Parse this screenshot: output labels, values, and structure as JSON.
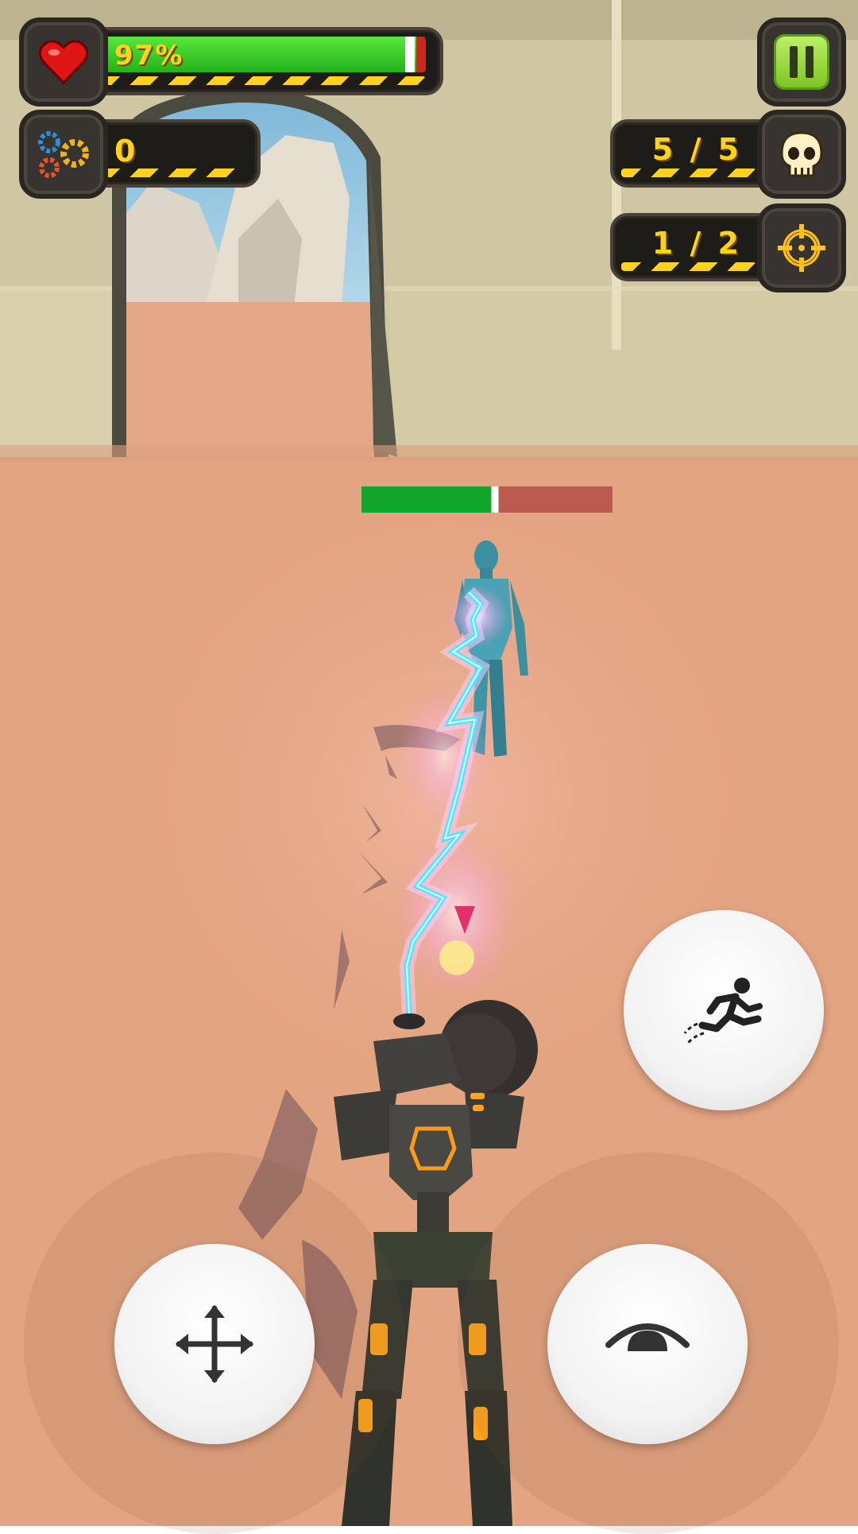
{
  "hud": {
    "health": {
      "icon": "heart-icon",
      "label": "97%",
      "level": 0.97
    },
    "gears": {
      "icon": "gears-icon",
      "count": "0"
    },
    "kills": {
      "icon": "skull-icon",
      "label": "5 / 5"
    },
    "targets": {
      "icon": "crosshair-icon",
      "label": "1 / 2"
    },
    "pause": {
      "icon": "pause-icon"
    }
  },
  "enemy": {
    "health_level": 0.53
  },
  "controls": {
    "dash": {
      "icon": "running-man-icon"
    },
    "move": {
      "icon": "move-arrows-icon"
    },
    "look": {
      "icon": "eye-icon"
    }
  },
  "colors": {
    "ground": "#e3a482",
    "wall": "#cfc6a3",
    "health_green": "#2ec81e",
    "enemy_green": "#12a62c",
    "enemy_red": "#bb5a4f",
    "hud_yellow": "#ffd21f",
    "lightning": "#4de8ff",
    "robot_glow": "#ff9a1a"
  }
}
